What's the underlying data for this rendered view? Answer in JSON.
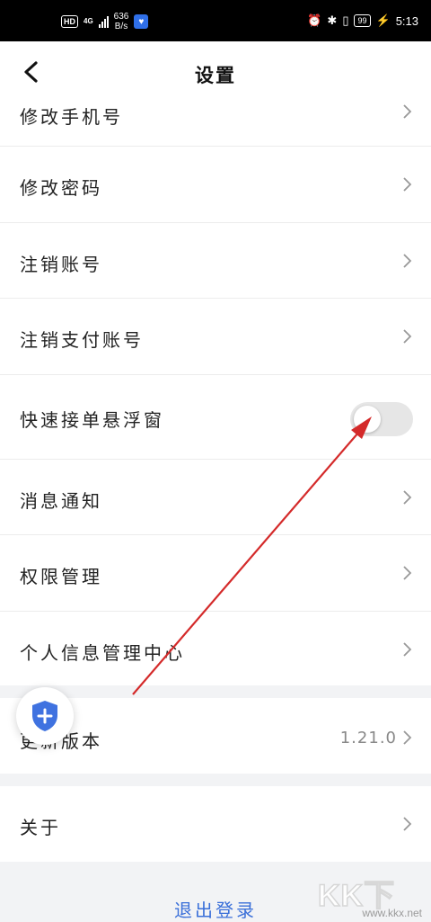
{
  "status_bar": {
    "hd": "HD",
    "network": "4G",
    "net_speed_value": "636",
    "net_speed_unit": "B/s",
    "battery": "99",
    "time": "5:13"
  },
  "header": {
    "title": "设置"
  },
  "settings": {
    "items": [
      {
        "label": "修改手机号"
      },
      {
        "label": "修改密码"
      },
      {
        "label": "注销账号"
      },
      {
        "label": "注销支付账号"
      },
      {
        "label": "快速接单悬浮窗",
        "toggle_on": false
      },
      {
        "label": "消息通知"
      },
      {
        "label": "权限管理"
      },
      {
        "label": "个人信息管理中心"
      }
    ],
    "version": {
      "label": "更新版本",
      "value": "1.21.0"
    },
    "about": {
      "label": "关于"
    },
    "logout_label": "退出登录"
  },
  "watermark": {
    "brand": "KK下载",
    "url": "www.kkx.net"
  },
  "colors": {
    "accent": "#3a6fd9",
    "annotation_arrow": "#d42a2a",
    "toggle_off": "#e6e6e6"
  }
}
